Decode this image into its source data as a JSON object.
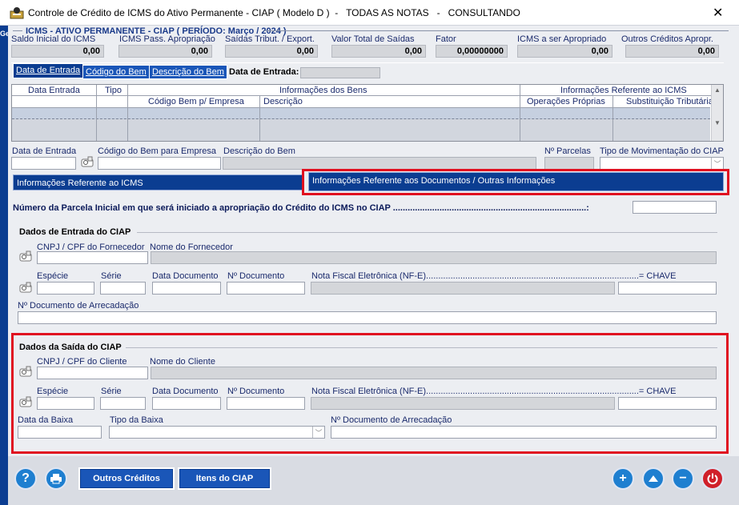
{
  "window": {
    "title": "Controle de Crédito de ICMS do Ativo Permanente - CIAP ( Modelo D )  -   TODAS AS NOTAS   -   CONSULTANDO",
    "close": "✕",
    "left_strip_label": "Ge"
  },
  "header": {
    "title": "ICMS - ATIVO PERMANENTE - CIAP ( PERÍODO:  Março / 2024 )",
    "fields": [
      {
        "label": "Saldo Inicial do ICMS",
        "value": "0,00"
      },
      {
        "label": "ICMS Pass. Apropriação",
        "value": "0,00"
      },
      {
        "label": "Saídas Tribut. / Export.",
        "value": "0,00"
      },
      {
        "label": "Valor Total de Saídas",
        "value": "0,00"
      },
      {
        "label": "Fator",
        "value": "0,00000000"
      },
      {
        "label": "ICMS a ser Apropriado",
        "value": "0,00"
      },
      {
        "label": "Outros Créditos Apropr.",
        "value": "0,00"
      }
    ]
  },
  "tabs": [
    {
      "label": "Data de Entrada",
      "selected": true
    },
    {
      "label": "Código do Bem",
      "selected": false
    },
    {
      "label": "Descrição do Bem",
      "selected": false
    }
  ],
  "search": {
    "label": "Data de Entrada:",
    "value": ""
  },
  "grid": {
    "group_bens": "Informações dos Bens",
    "group_icms": "Informações Referente ao ICMS",
    "columns": [
      "Data Entrada",
      "Tipo",
      "Código Bem p/ Empresa",
      "Descrição",
      "Operações Próprias",
      "Substituição Tributária"
    ]
  },
  "detail": {
    "data_entrada": "Data de Entrada",
    "codigo_bem": "Código do Bem para Empresa",
    "descricao_bem": "Descrição do Bem",
    "n_parcelas": "Nº Parcelas",
    "tipo_mov": "Tipo de Movimentação do CIAP"
  },
  "section_tabs": {
    "icms": "Informações Referente ao ICMS",
    "docs": "Informações Referente aos Documentos / Outras Informações"
  },
  "parcela": {
    "label": "Número da Parcela Inicial em que será iniciado a apropriação do Crédito do ICMS no CIAP ...............................................................................:",
    "value": ""
  },
  "entrada": {
    "title": "Dados de Entrada do CIAP",
    "cnpj": "CNPJ / CPF do Fornecedor",
    "nome": "Nome do Fornecedor",
    "especie": "Espécie",
    "serie": "Série",
    "data_doc": "Data Documento",
    "n_doc": "Nº Documento",
    "nfe": "Nota Fiscal Eletrônica (NF-E).......................................................................................= CHAVE",
    "arrecadacao": "Nº Documento de Arrecadação"
  },
  "saida": {
    "title": "Dados da Saída do CIAP",
    "cnpj": "CNPJ / CPF do Cliente",
    "nome": "Nome do Cliente",
    "especie": "Espécie",
    "serie": "Série",
    "data_doc": "Data Documento",
    "n_doc": "Nº Documento",
    "nfe": "Nota Fiscal Eletrônica (NF-E).......................................................................................= CHAVE",
    "data_baixa": "Data da Baixa",
    "tipo_baixa": "Tipo da Baixa",
    "arrecadacao": "Nº Documento de Arrecadação"
  },
  "footer": {
    "help": "?",
    "outros_creditos": "Outros Créditos",
    "itens_ciap": "Itens do CIAP"
  },
  "colors": {
    "accent": "#0b3d91",
    "highlight": "#e01020"
  }
}
